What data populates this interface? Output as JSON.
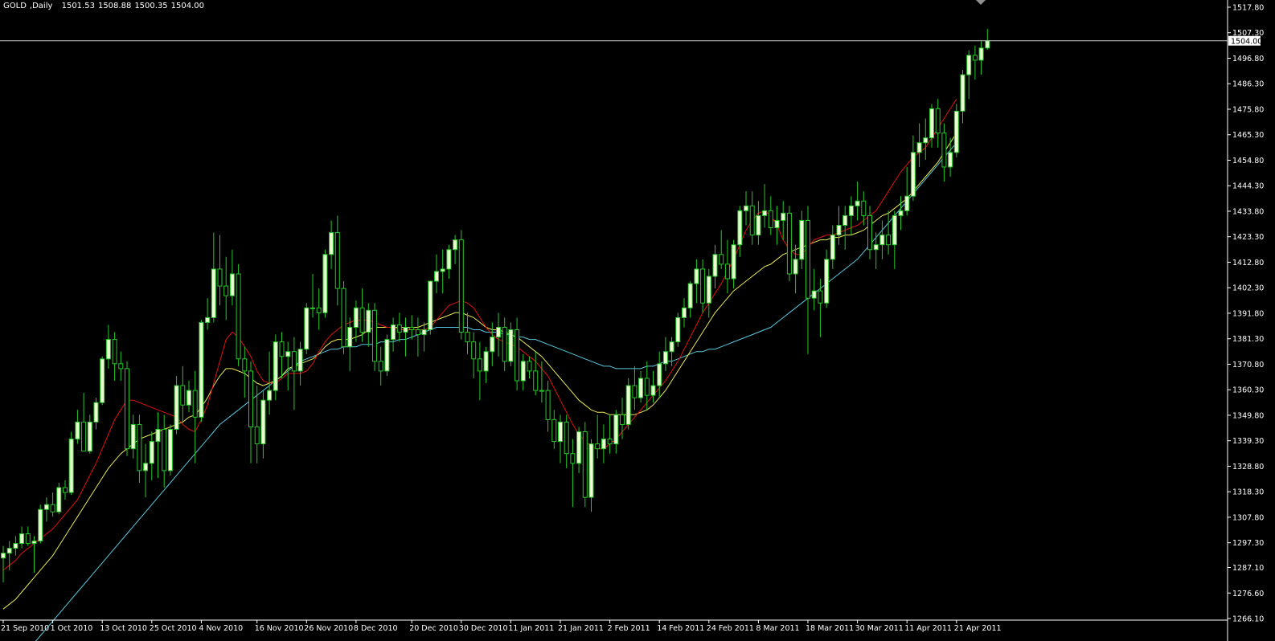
{
  "window": {
    "symbol": "GOLD",
    "timeframe": "Daily",
    "open": "1501.53",
    "high": "1508.88",
    "low": "1500.35",
    "close": "1504.00"
  },
  "colors": {
    "background": "#000000",
    "bull_body": "#e8ffd0",
    "bear_body": "#000000",
    "wick": "#26c826",
    "axis": "#ffffff",
    "ma_fast": "#e01010",
    "ma_mid": "#e8e85a",
    "ma_slow": "#5ac8e0",
    "price_line": "#c8c8c8"
  },
  "chart_data": {
    "type": "candlestick",
    "symbol": "GOLD",
    "timeframe": "Daily",
    "current_price": "1504.00",
    "ylim": [
      1266.1,
      1517.8
    ],
    "y_ticks": [
      "1517.80",
      "1507.30",
      "1496.80",
      "1486.30",
      "1475.80",
      "1465.30",
      "1454.80",
      "1444.30",
      "1433.80",
      "1423.30",
      "1412.80",
      "1402.30",
      "1391.80",
      "1381.30",
      "1370.80",
      "1360.30",
      "1349.80",
      "1339.30",
      "1328.80",
      "1318.30",
      "1307.80",
      "1297.30",
      "1287.10",
      "1276.60",
      "1266.10"
    ],
    "x_ticks": [
      {
        "label": "21 Sep 2010",
        "bar": 0
      },
      {
        "label": "1 Oct 2010",
        "bar": 8
      },
      {
        "label": "13 Oct 2010",
        "bar": 16
      },
      {
        "label": "25 Oct 2010",
        "bar": 24
      },
      {
        "label": "4 Nov 2010",
        "bar": 32
      },
      {
        "label": "16 Nov 2010",
        "bar": 41
      },
      {
        "label": "26 Nov 2010",
        "bar": 49
      },
      {
        "label": "8 Dec 2010",
        "bar": 57
      },
      {
        "label": "20 Dec 2010",
        "bar": 66
      },
      {
        "label": "30 Dec 2010",
        "bar": 74
      },
      {
        "label": "11 Jan 2011",
        "bar": 82
      },
      {
        "label": "21 Jan 2011",
        "bar": 90
      },
      {
        "label": "2 Feb 2011",
        "bar": 98
      },
      {
        "label": "14 Feb 2011",
        "bar": 106
      },
      {
        "label": "24 Feb 2011",
        "bar": 114
      },
      {
        "label": "8 Mar 2011",
        "bar": 122
      },
      {
        "label": "18 Mar 2011",
        "bar": 130
      },
      {
        "label": "30 Mar 2011",
        "bar": 138
      },
      {
        "label": "11 Apr 2011",
        "bar": 146
      },
      {
        "label": "21 Apr 2011",
        "bar": 154
      }
    ],
    "candles": [
      [
        1291,
        1296,
        1281,
        1293
      ],
      [
        1293,
        1298,
        1286,
        1295
      ],
      [
        1295,
        1300,
        1292,
        1297
      ],
      [
        1297,
        1304,
        1295,
        1301
      ],
      [
        1301,
        1304,
        1296,
        1297
      ],
      [
        1297,
        1300,
        1285,
        1298
      ],
      [
        1298,
        1313,
        1297,
        1311
      ],
      [
        1311,
        1316,
        1306,
        1313
      ],
      [
        1313,
        1318,
        1308,
        1310
      ],
      [
        1310,
        1322,
        1309,
        1320
      ],
      [
        1320,
        1323,
        1315,
        1318
      ],
      [
        1318,
        1343,
        1317,
        1340
      ],
      [
        1340,
        1352,
        1338,
        1347
      ],
      [
        1347,
        1359,
        1342,
        1335
      ],
      [
        1335,
        1350,
        1334,
        1347
      ],
      [
        1347,
        1357,
        1344,
        1355
      ],
      [
        1355,
        1374,
        1354,
        1373
      ],
      [
        1373,
        1387,
        1369,
        1381
      ],
      [
        1381,
        1384,
        1364,
        1371
      ],
      [
        1371,
        1376,
        1364,
        1369
      ],
      [
        1369,
        1372,
        1333,
        1336
      ],
      [
        1336,
        1350,
        1332,
        1346
      ],
      [
        1346,
        1350,
        1322,
        1327
      ],
      [
        1327,
        1338,
        1316,
        1330
      ],
      [
        1330,
        1343,
        1323,
        1339
      ],
      [
        1339,
        1351,
        1324,
        1344
      ],
      [
        1344,
        1350,
        1320,
        1327
      ],
      [
        1327,
        1346,
        1325,
        1344
      ],
      [
        1344,
        1366,
        1342,
        1362
      ],
      [
        1362,
        1370,
        1347,
        1354
      ],
      [
        1354,
        1364,
        1351,
        1360
      ],
      [
        1360,
        1368,
        1330,
        1349
      ],
      [
        1349,
        1389,
        1347,
        1388
      ],
      [
        1388,
        1398,
        1385,
        1390
      ],
      [
        1390,
        1425,
        1388,
        1410
      ],
      [
        1410,
        1424,
        1395,
        1403
      ],
      [
        1403,
        1415,
        1389,
        1399
      ],
      [
        1399,
        1418,
        1395,
        1408
      ],
      [
        1408,
        1412,
        1370,
        1373
      ],
      [
        1373,
        1378,
        1357,
        1368
      ],
      [
        1368,
        1372,
        1330,
        1345
      ],
      [
        1345,
        1362,
        1330,
        1338
      ],
      [
        1338,
        1360,
        1332,
        1356
      ],
      [
        1356,
        1376,
        1350,
        1360
      ],
      [
        1360,
        1383,
        1356,
        1380
      ],
      [
        1380,
        1384,
        1365,
        1374
      ],
      [
        1374,
        1380,
        1360,
        1376
      ],
      [
        1376,
        1382,
        1352,
        1368
      ],
      [
        1368,
        1380,
        1362,
        1377
      ],
      [
        1377,
        1396,
        1375,
        1394
      ],
      [
        1394,
        1408,
        1390,
        1394
      ],
      [
        1394,
        1402,
        1385,
        1392
      ],
      [
        1392,
        1418,
        1390,
        1416
      ],
      [
        1416,
        1430,
        1410,
        1425
      ],
      [
        1425,
        1432,
        1395,
        1402
      ],
      [
        1402,
        1405,
        1375,
        1378
      ],
      [
        1378,
        1390,
        1368,
        1386
      ],
      [
        1386,
        1397,
        1380,
        1394
      ],
      [
        1394,
        1402,
        1380,
        1384
      ],
      [
        1384,
        1396,
        1378,
        1393
      ],
      [
        1393,
        1396,
        1368,
        1372
      ],
      [
        1372,
        1378,
        1362,
        1368
      ],
      [
        1368,
        1383,
        1366,
        1381
      ],
      [
        1381,
        1390,
        1376,
        1387
      ],
      [
        1387,
        1392,
        1380,
        1384
      ],
      [
        1384,
        1390,
        1374,
        1386
      ],
      [
        1386,
        1391,
        1381,
        1385
      ],
      [
        1385,
        1390,
        1374,
        1383
      ],
      [
        1383,
        1388,
        1376,
        1385
      ],
      [
        1385,
        1398,
        1383,
        1405
      ],
      [
        1405,
        1416,
        1400,
        1409
      ],
      [
        1409,
        1418,
        1400,
        1410
      ],
      [
        1410,
        1420,
        1406,
        1418
      ],
      [
        1418,
        1424,
        1412,
        1422
      ],
      [
        1422,
        1426,
        1381,
        1384
      ],
      [
        1384,
        1392,
        1375,
        1380
      ],
      [
        1380,
        1384,
        1365,
        1373
      ],
      [
        1373,
        1380,
        1356,
        1368
      ],
      [
        1368,
        1378,
        1363,
        1376
      ],
      [
        1376,
        1388,
        1370,
        1382
      ],
      [
        1382,
        1392,
        1374,
        1386
      ],
      [
        1386,
        1390,
        1368,
        1372
      ],
      [
        1372,
        1388,
        1370,
        1385
      ],
      [
        1385,
        1390,
        1360,
        1364
      ],
      [
        1364,
        1375,
        1360,
        1372
      ],
      [
        1372,
        1374,
        1365,
        1368
      ],
      [
        1368,
        1376,
        1358,
        1360
      ],
      [
        1360,
        1372,
        1355,
        1360
      ],
      [
        1360,
        1364,
        1343,
        1348
      ],
      [
        1348,
        1352,
        1336,
        1339
      ],
      [
        1339,
        1350,
        1330,
        1347
      ],
      [
        1347,
        1350,
        1328,
        1334
      ],
      [
        1334,
        1340,
        1312,
        1330
      ],
      [
        1330,
        1345,
        1326,
        1343
      ],
      [
        1343,
        1347,
        1312,
        1316
      ],
      [
        1316,
        1340,
        1310,
        1338
      ],
      [
        1338,
        1350,
        1332,
        1336
      ],
      [
        1336,
        1346,
        1330,
        1340
      ],
      [
        1340,
        1350,
        1334,
        1338
      ],
      [
        1338,
        1352,
        1334,
        1350
      ],
      [
        1350,
        1357,
        1340,
        1346
      ],
      [
        1346,
        1365,
        1344,
        1362
      ],
      [
        1362,
        1370,
        1352,
        1357
      ],
      [
        1357,
        1368,
        1355,
        1365
      ],
      [
        1365,
        1372,
        1352,
        1358
      ],
      [
        1358,
        1368,
        1355,
        1362
      ],
      [
        1362,
        1376,
        1357,
        1371
      ],
      [
        1371,
        1382,
        1368,
        1376
      ],
      [
        1376,
        1382,
        1370,
        1380
      ],
      [
        1380,
        1392,
        1378,
        1390
      ],
      [
        1390,
        1398,
        1386,
        1394
      ],
      [
        1394,
        1405,
        1390,
        1404
      ],
      [
        1404,
        1414,
        1396,
        1410
      ],
      [
        1410,
        1414,
        1392,
        1396
      ],
      [
        1396,
        1410,
        1390,
        1407
      ],
      [
        1407,
        1420,
        1402,
        1416
      ],
      [
        1416,
        1426,
        1410,
        1412
      ],
      [
        1412,
        1422,
        1400,
        1406
      ],
      [
        1406,
        1422,
        1402,
        1420
      ],
      [
        1420,
        1436,
        1415,
        1434
      ],
      [
        1434,
        1442,
        1428,
        1436
      ],
      [
        1436,
        1442,
        1420,
        1424
      ],
      [
        1424,
        1438,
        1420,
        1432
      ],
      [
        1432,
        1445,
        1427,
        1434
      ],
      [
        1434,
        1440,
        1424,
        1427
      ],
      [
        1427,
        1436,
        1420,
        1430
      ],
      [
        1430,
        1438,
        1422,
        1433
      ],
      [
        1433,
        1436,
        1405,
        1408
      ],
      [
        1408,
        1420,
        1400,
        1414
      ],
      [
        1414,
        1434,
        1410,
        1430
      ],
      [
        1430,
        1436,
        1375,
        1398
      ],
      [
        1398,
        1410,
        1393,
        1401
      ],
      [
        1401,
        1406,
        1382,
        1396
      ],
      [
        1396,
        1418,
        1394,
        1414
      ],
      [
        1414,
        1428,
        1410,
        1424
      ],
      [
        1424,
        1436,
        1420,
        1428
      ],
      [
        1428,
        1436,
        1418,
        1432
      ],
      [
        1432,
        1440,
        1424,
        1436
      ],
      [
        1436,
        1446,
        1430,
        1438
      ],
      [
        1438,
        1442,
        1428,
        1432
      ],
      [
        1432,
        1436,
        1414,
        1418
      ],
      [
        1418,
        1425,
        1410,
        1420
      ],
      [
        1420,
        1430,
        1414,
        1424
      ],
      [
        1424,
        1434,
        1416,
        1420
      ],
      [
        1420,
        1434,
        1410,
        1432
      ],
      [
        1432,
        1440,
        1426,
        1434
      ],
      [
        1434,
        1452,
        1432,
        1440
      ],
      [
        1440,
        1465,
        1438,
        1458
      ],
      [
        1458,
        1470,
        1452,
        1462
      ],
      [
        1462,
        1472,
        1455,
        1464
      ],
      [
        1464,
        1478,
        1460,
        1476
      ],
      [
        1476,
        1480,
        1460,
        1466
      ],
      [
        1466,
        1470,
        1446,
        1452
      ],
      [
        1452,
        1464,
        1448,
        1458
      ],
      [
        1458,
        1478,
        1456,
        1475
      ],
      [
        1475,
        1492,
        1470,
        1490
      ],
      [
        1490,
        1500,
        1480,
        1498
      ],
      [
        1498,
        1502,
        1488,
        1496
      ],
      [
        1496,
        1504,
        1490,
        1501
      ],
      [
        1501,
        1508.88,
        1500.35,
        1504
      ]
    ],
    "ma_fast": [
      1286,
      1288,
      1290,
      1293,
      1295,
      1297,
      1299,
      1301,
      1303,
      1306,
      1309,
      1312,
      1315,
      1320,
      1325,
      1330,
      1336,
      1342,
      1348,
      1352,
      1356,
      1356,
      1355,
      1354,
      1353,
      1352,
      1351,
      1350,
      1349,
      1346,
      1344,
      1343,
      1348,
      1354,
      1363,
      1372,
      1381,
      1384,
      1382,
      1378,
      1374,
      1368,
      1364,
      1363,
      1363,
      1365,
      1367,
      1367,
      1367,
      1368,
      1371,
      1376,
      1380,
      1383,
      1385,
      1387,
      1388,
      1389,
      1389,
      1389,
      1388,
      1387,
      1386,
      1386,
      1385,
      1385,
      1385,
      1385,
      1385,
      1386,
      1389,
      1392,
      1395,
      1396,
      1397,
      1396,
      1394,
      1390,
      1386,
      1383,
      1381,
      1380,
      1379,
      1378,
      1376,
      1374,
      1372,
      1369,
      1366,
      1361,
      1356,
      1351,
      1346,
      1342,
      1339,
      1337,
      1336,
      1336,
      1338,
      1340,
      1343,
      1346,
      1349,
      1352,
      1355,
      1358,
      1361,
      1364,
      1368,
      1372,
      1377,
      1382,
      1387,
      1392,
      1396,
      1400,
      1404,
      1409,
      1414,
      1420,
      1426,
      1430,
      1433,
      1434,
      1432,
      1428,
      1422,
      1418,
      1416,
      1416,
      1419,
      1422,
      1423,
      1424,
      1424,
      1425,
      1426,
      1427,
      1428,
      1430,
      1432,
      1434,
      1438,
      1442,
      1446,
      1450,
      1453,
      1456,
      1458,
      1460,
      1464,
      1468,
      1472,
      1476,
      1480
    ],
    "ma_mid": [
      1270,
      1272,
      1274,
      1277,
      1280,
      1283,
      1286,
      1289,
      1292,
      1296,
      1300,
      1304,
      1308,
      1312,
      1316,
      1320,
      1324,
      1328,
      1331,
      1334,
      1336,
      1338,
      1340,
      1341,
      1342,
      1343,
      1344,
      1345,
      1346,
      1347,
      1349,
      1350,
      1353,
      1357,
      1362,
      1366,
      1369,
      1369,
      1368,
      1367,
      1365,
      1363,
      1362,
      1363,
      1364,
      1366,
      1369,
      1370,
      1371,
      1372,
      1373,
      1375,
      1378,
      1380,
      1381,
      1381,
      1381,
      1382,
      1383,
      1385,
      1386,
      1386,
      1386,
      1386,
      1386,
      1386,
      1386,
      1386,
      1387,
      1388,
      1389,
      1390,
      1391,
      1392,
      1392,
      1391,
      1390,
      1388,
      1386,
      1385,
      1385,
      1384,
      1383,
      1382,
      1380,
      1378,
      1376,
      1374,
      1371,
      1368,
      1365,
      1362,
      1359,
      1356,
      1354,
      1352,
      1351,
      1351,
      1350,
      1350,
      1350,
      1350,
      1350,
      1351,
      1352,
      1354,
      1357,
      1360,
      1364,
      1368,
      1372,
      1376,
      1380,
      1384,
      1388,
      1392,
      1395,
      1398,
      1401,
      1403,
      1405,
      1407,
      1409,
      1411,
      1412,
      1414,
      1416,
      1417,
      1418,
      1419,
      1420,
      1421,
      1422,
      1422,
      1423,
      1423,
      1424,
      1424,
      1425,
      1426,
      1428,
      1430,
      1432,
      1433,
      1435,
      1437,
      1439,
      1442,
      1445,
      1448,
      1451,
      1454,
      1458,
      1462,
      1466
    ],
    "ma_slow": [
      1245,
      1247,
      1249,
      1251,
      1253,
      1256,
      1259,
      1262,
      1265,
      1268,
      1271,
      1274,
      1277,
      1280,
      1283,
      1286,
      1289,
      1292,
      1295,
      1298,
      1301,
      1304,
      1307,
      1310,
      1313,
      1316,
      1319,
      1322,
      1325,
      1328,
      1331,
      1334,
      1337,
      1340,
      1343,
      1346,
      1348,
      1350,
      1352,
      1354,
      1356,
      1358,
      1360,
      1362,
      1364,
      1366,
      1368,
      1370,
      1372,
      1373,
      1374,
      1375,
      1376,
      1377,
      1377,
      1378,
      1378,
      1378,
      1379,
      1379,
      1379,
      1380,
      1380,
      1380,
      1381,
      1381,
      1382,
      1383,
      1384,
      1385,
      1386,
      1386,
      1386,
      1386,
      1386,
      1386,
      1385,
      1385,
      1384,
      1384,
      1384,
      1383,
      1383,
      1382,
      1382,
      1381,
      1381,
      1380,
      1379,
      1378,
      1377,
      1376,
      1375,
      1374,
      1373,
      1372,
      1371,
      1370,
      1370,
      1369,
      1369,
      1369,
      1369,
      1369,
      1370,
      1370,
      1371,
      1372,
      1372,
      1373,
      1374,
      1375,
      1376,
      1376,
      1377,
      1377,
      1378,
      1379,
      1380,
      1381,
      1382,
      1383,
      1384,
      1385,
      1386,
      1388,
      1390,
      1392,
      1394,
      1396,
      1398,
      1400,
      1402,
      1404,
      1406,
      1408,
      1410,
      1412,
      1414,
      1417,
      1420,
      1423,
      1426,
      1429,
      1432,
      1435,
      1438,
      1441,
      1444,
      1447,
      1450,
      1453,
      1456,
      1459,
      1462
    ]
  }
}
